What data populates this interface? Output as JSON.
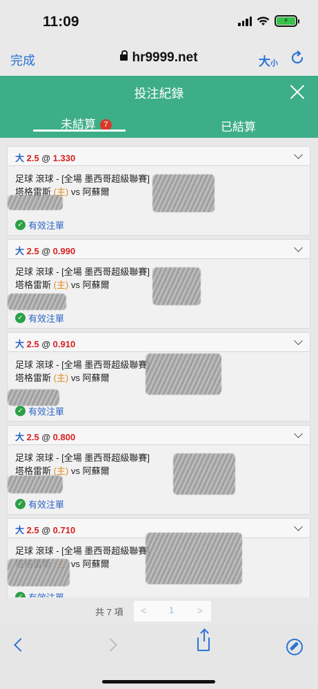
{
  "status_bar": {
    "time": "11:09",
    "battery_color": "#39c24a"
  },
  "browser": {
    "done_label": "完成",
    "url": "hr9999.net",
    "text_size_big": "大",
    "text_size_small": "小",
    "reload_icon": "reload-icon"
  },
  "modal": {
    "title": "投注紀錄",
    "header_color": "#3dae87"
  },
  "tabs": {
    "pending": {
      "label": "未結算",
      "badge": "7"
    },
    "settled": {
      "label": "已結算"
    }
  },
  "bets": [
    {
      "ou": "大",
      "line": "2.5",
      "at": "@",
      "odds": "1.330",
      "sport": "足球 滾球 - [全場 墨西哥超級聯賽]",
      "home_team": "塔格雷斯",
      "home_tag": "(主)",
      "vs": "vs",
      "away_team": "阿蘇爾",
      "status": "有效注單"
    },
    {
      "ou": "大",
      "line": "2.5",
      "at": "@",
      "odds": "0.990",
      "sport": "足球 滾球 - [全場 墨西哥超級聯賽]",
      "home_team": "塔格雷斯",
      "home_tag": "(主)",
      "vs": "vs",
      "away_team": "阿蘇爾",
      "status": "有效注單"
    },
    {
      "ou": "大",
      "line": "2.5",
      "at": "@",
      "odds": "0.910",
      "sport": "足球 滾球 - [全場 墨西哥超級聯賽]",
      "home_team": "塔格雷斯",
      "home_tag": "(主)",
      "vs": "vs",
      "away_team": "阿蘇爾",
      "status": "有效注單"
    },
    {
      "ou": "大",
      "line": "2.5",
      "at": "@",
      "odds": "0.800",
      "sport": "足球 滾球 - [全場 墨西哥超級聯賽]",
      "home_team": "塔格雷斯",
      "home_tag": "(主)",
      "vs": "vs",
      "away_team": "阿蘇爾",
      "status": "有效注單"
    },
    {
      "ou": "大",
      "line": "2.5",
      "at": "@",
      "odds": "0.710",
      "sport": "足球 滾球 - [全場 墨西哥超級聯賽]",
      "home_team": "塔格雷斯",
      "home_tag": "(主)",
      "vs": "vs",
      "away_team": "阿蘇爾",
      "status": "有效注單"
    }
  ],
  "pagination": {
    "total": "共 7 項",
    "prev": "<",
    "page": "1",
    "next": ">"
  },
  "toolbar": {
    "icons": [
      "back-icon",
      "forward-icon",
      "share-icon",
      "compass-icon"
    ]
  }
}
